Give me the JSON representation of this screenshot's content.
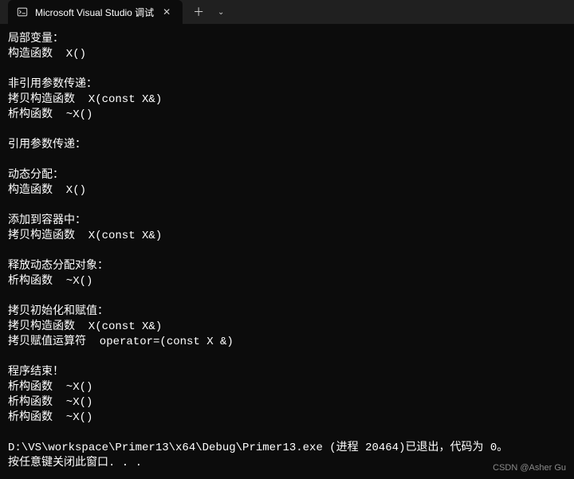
{
  "titlebar": {
    "tab_title": "Microsoft Visual Studio 调试",
    "close_glyph": "✕",
    "new_tab_glyph": "＋",
    "dropdown_glyph": "⌄"
  },
  "console": {
    "lines": [
      "局部变量：",
      "构造函数  X()",
      "",
      "非引用参数传递：",
      "拷贝构造函数  X(const X&)",
      "析构函数  ~X()",
      "",
      "引用参数传递：",
      "",
      "动态分配：",
      "构造函数  X()",
      "",
      "添加到容器中：",
      "拷贝构造函数  X(const X&)",
      "",
      "释放动态分配对象：",
      "析构函数  ~X()",
      "",
      "拷贝初始化和赋值：",
      "拷贝构造函数  X(const X&)",
      "拷贝赋值运算符  operator=(const X &)",
      "",
      "程序结束！",
      "析构函数  ~X()",
      "析构函数  ~X()",
      "析构函数  ~X()",
      "",
      "D:\\VS\\workspace\\Primer13\\x64\\Debug\\Primer13.exe (进程 20464)已退出，代码为 0。",
      "按任意键关闭此窗口. . ."
    ]
  },
  "watermark": "CSDN @Asher Gu"
}
